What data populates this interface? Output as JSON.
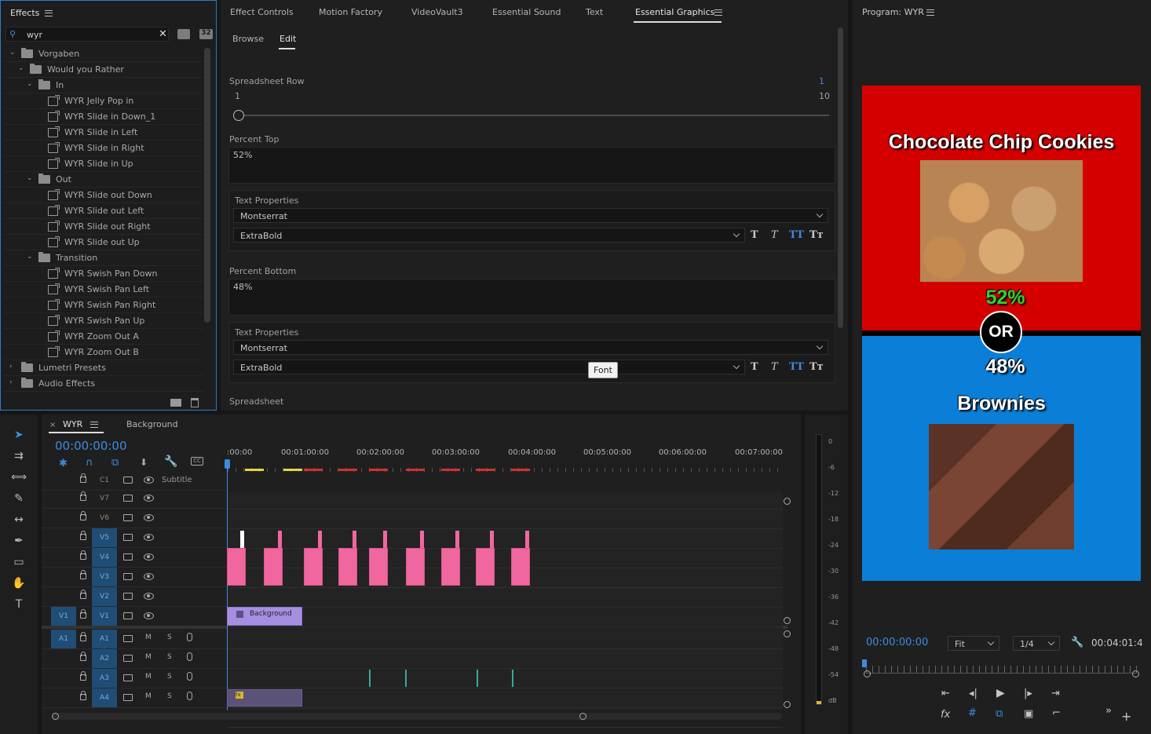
{
  "effects_panel": {
    "tab_label": "Effects",
    "search_value": "wyr",
    "tree": [
      {
        "label": "Vorgaben",
        "kind": "folder",
        "depth": 0,
        "expanded": true
      },
      {
        "label": "Would you Rather",
        "kind": "folder",
        "depth": 1,
        "expanded": true
      },
      {
        "label": "In",
        "kind": "folder",
        "depth": 2,
        "expanded": true
      },
      {
        "label": "WYR Jelly Pop in",
        "kind": "preset",
        "depth": 3
      },
      {
        "label": "WYR Slide in Down_1",
        "kind": "preset",
        "depth": 3
      },
      {
        "label": "WYR Slide in Left",
        "kind": "preset",
        "depth": 3
      },
      {
        "label": "WYR Slide in Right",
        "kind": "preset",
        "depth": 3
      },
      {
        "label": "WYR Slide in Up",
        "kind": "preset",
        "depth": 3
      },
      {
        "label": "Out",
        "kind": "folder",
        "depth": 2,
        "expanded": true
      },
      {
        "label": "WYR Slide out Down",
        "kind": "preset",
        "depth": 3
      },
      {
        "label": "WYR Slide out Left",
        "kind": "preset",
        "depth": 3
      },
      {
        "label": "WYR Slide out Right",
        "kind": "preset",
        "depth": 3
      },
      {
        "label": "WYR Slide out Up",
        "kind": "preset",
        "depth": 3
      },
      {
        "label": "Transition",
        "kind": "folder",
        "depth": 2,
        "expanded": true
      },
      {
        "label": "WYR Swish Pan Down",
        "kind": "preset",
        "depth": 3
      },
      {
        "label": "WYR Swish Pan Left",
        "kind": "preset",
        "depth": 3
      },
      {
        "label": "WYR Swish Pan Right",
        "kind": "preset",
        "depth": 3
      },
      {
        "label": "WYR Swish Pan Up",
        "kind": "preset",
        "depth": 3
      },
      {
        "label": "WYR Zoom Out A",
        "kind": "preset",
        "depth": 3
      },
      {
        "label": "WYR Zoom Out B",
        "kind": "preset",
        "depth": 3
      },
      {
        "label": "Lumetri Presets",
        "kind": "folder",
        "depth": 0,
        "expanded": false
      },
      {
        "label": "Audio Effects",
        "kind": "folder",
        "depth": 0,
        "expanded": false
      }
    ],
    "badge_32": "32"
  },
  "center_tabs": [
    "Effect Controls",
    "Motion Factory",
    "VideoVault3",
    "Essential Sound",
    "Text",
    "Essential Graphics"
  ],
  "essential_graphics": {
    "subtabs": [
      "Browse",
      "Edit"
    ],
    "spreadsheet_row_label": "Spreadsheet Row",
    "spreadsheet_row_value": "1",
    "slider_min": "1",
    "slider_max": "10",
    "percent_top_label": "Percent Top",
    "percent_top_value": "52%",
    "text_properties_label": "Text Properties",
    "font_family": "Montserrat",
    "font_style": "ExtraBold",
    "percent_bottom_label": "Percent Bottom",
    "percent_bottom_value": "48%",
    "tooltip": "Font",
    "spreadsheet_label": "Spreadsheet",
    "text_buttons": [
      "T",
      "T",
      "TT",
      "Tт"
    ]
  },
  "program_monitor": {
    "title": "Program: WYR",
    "top_caption": "Chocolate Chip Cookies",
    "top_percent": "52%",
    "or_label": "OR",
    "bottom_percent": "48%",
    "bottom_caption": "Brownies",
    "timecode": "00:00:00:00",
    "fit": "Fit",
    "resolution": "1/4",
    "duration": "00:04:01:4",
    "colors": {
      "top": "#d40000",
      "bottom": "#0b7fd8",
      "top_pct": "#2fd12f"
    }
  },
  "timeline": {
    "tab": "WYR",
    "tab2": "Background",
    "timecode": "00:00:00:00",
    "ruler": [
      ":00:00",
      "00:01:00:00",
      "00:02:00:00",
      "00:03:00:00",
      "00:04:00:00",
      "00:05:00:00",
      "00:06:00:00",
      "00:07:00:00"
    ],
    "caption_track": {
      "name": "C1",
      "label": "Subtitle"
    },
    "video_tracks": [
      "V7",
      "V6",
      "V5",
      "V4",
      "V3",
      "V2",
      "V1"
    ],
    "audio_tracks": [
      "A1",
      "A2",
      "A3",
      "A4"
    ],
    "source_v": "V1",
    "source_a": "A1",
    "background_clip": "Background",
    "mute_label": "M",
    "solo_label": "S"
  },
  "meter_scale": [
    "0",
    "-6",
    "-12",
    "-18",
    "-24",
    "-30",
    "-36",
    "-42",
    "-48",
    "-54",
    "dB"
  ]
}
